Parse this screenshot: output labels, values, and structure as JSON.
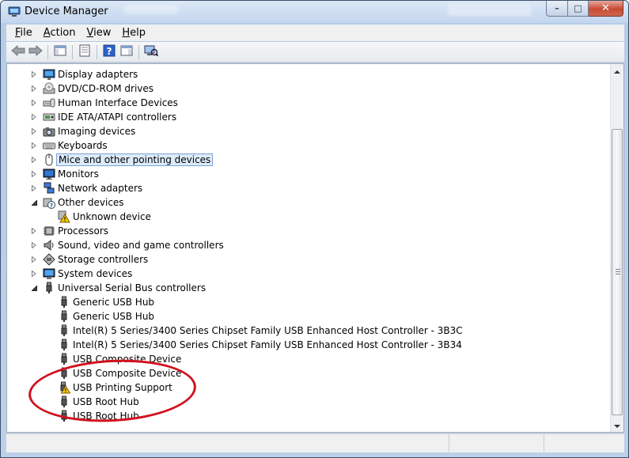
{
  "window": {
    "title": "Device Manager"
  },
  "caption_buttons": {
    "minimize": "–",
    "maximize": "□",
    "close": "✕"
  },
  "menu": [
    {
      "label": "File",
      "accel": "F",
      "rest": "ile"
    },
    {
      "label": "Action",
      "accel": "A",
      "rest": "ction"
    },
    {
      "label": "View",
      "accel": "V",
      "rest": "iew"
    },
    {
      "label": "Help",
      "accel": "H",
      "rest": "elp"
    }
  ],
  "toolbar": {
    "buttons": [
      "back-icon",
      "forward-icon",
      "show-hide-console-tree-icon",
      "properties-icon",
      "help-icon",
      "action-pane-icon",
      "scan-hardware-icon"
    ]
  },
  "tree": [
    {
      "label": "Display adapters",
      "level": 0,
      "expander": "collapsed",
      "icon": "display-adapter-icon"
    },
    {
      "label": "DVD/CD-ROM drives",
      "level": 0,
      "expander": "collapsed",
      "icon": "dvd-drive-icon"
    },
    {
      "label": "Human Interface Devices",
      "level": 0,
      "expander": "collapsed",
      "icon": "hid-icon"
    },
    {
      "label": "IDE ATA/ATAPI controllers",
      "level": 0,
      "expander": "collapsed",
      "icon": "ide-controller-icon"
    },
    {
      "label": "Imaging devices",
      "level": 0,
      "expander": "collapsed",
      "icon": "camera-icon"
    },
    {
      "label": "Keyboards",
      "level": 0,
      "expander": "collapsed",
      "icon": "keyboard-icon"
    },
    {
      "label": "Mice and other pointing devices",
      "level": 0,
      "expander": "collapsed",
      "icon": "mouse-icon",
      "selected": true
    },
    {
      "label": "Monitors",
      "level": 0,
      "expander": "collapsed",
      "icon": "monitor-icon"
    },
    {
      "label": "Network adapters",
      "level": 0,
      "expander": "collapsed",
      "icon": "network-adapter-icon"
    },
    {
      "label": "Other devices",
      "level": 0,
      "expander": "expanded",
      "icon": "unknown-device-category-icon"
    },
    {
      "label": "Unknown device",
      "level": 1,
      "expander": "none",
      "icon": "warning-device-icon"
    },
    {
      "label": "Processors",
      "level": 0,
      "expander": "collapsed",
      "icon": "processor-icon"
    },
    {
      "label": "Sound, video and game controllers",
      "level": 0,
      "expander": "collapsed",
      "icon": "speaker-icon"
    },
    {
      "label": "Storage controllers",
      "level": 0,
      "expander": "collapsed",
      "icon": "storage-controller-icon"
    },
    {
      "label": "System devices",
      "level": 0,
      "expander": "collapsed",
      "icon": "system-device-icon"
    },
    {
      "label": "Universal Serial Bus controllers",
      "level": 0,
      "expander": "expanded",
      "icon": "usb-icon"
    },
    {
      "label": "Generic USB Hub",
      "level": 1,
      "expander": "none",
      "icon": "usb-icon"
    },
    {
      "label": "Generic USB Hub",
      "level": 1,
      "expander": "none",
      "icon": "usb-icon"
    },
    {
      "label": "Intel(R) 5 Series/3400 Series Chipset Family USB Enhanced Host Controller - 3B3C",
      "level": 1,
      "expander": "none",
      "icon": "usb-icon"
    },
    {
      "label": "Intel(R) 5 Series/3400 Series Chipset Family USB Enhanced Host Controller - 3B34",
      "level": 1,
      "expander": "none",
      "icon": "usb-icon"
    },
    {
      "label": "USB Composite Device",
      "level": 1,
      "expander": "none",
      "icon": "usb-icon"
    },
    {
      "label": "USB Composite Device",
      "level": 1,
      "expander": "none",
      "icon": "usb-icon"
    },
    {
      "label": "USB Printing Support",
      "level": 1,
      "expander": "none",
      "icon": "usb-warning-icon"
    },
    {
      "label": "USB Root Hub",
      "level": 1,
      "expander": "none",
      "icon": "usb-icon"
    },
    {
      "label": "USB Root Hub",
      "level": 1,
      "expander": "none",
      "icon": "usb-icon"
    }
  ],
  "colors": {
    "annotation": "#d2111e",
    "selection_bg": "#dcebfc",
    "selection_border": "#7da2ce",
    "warning": "#f5c400"
  }
}
